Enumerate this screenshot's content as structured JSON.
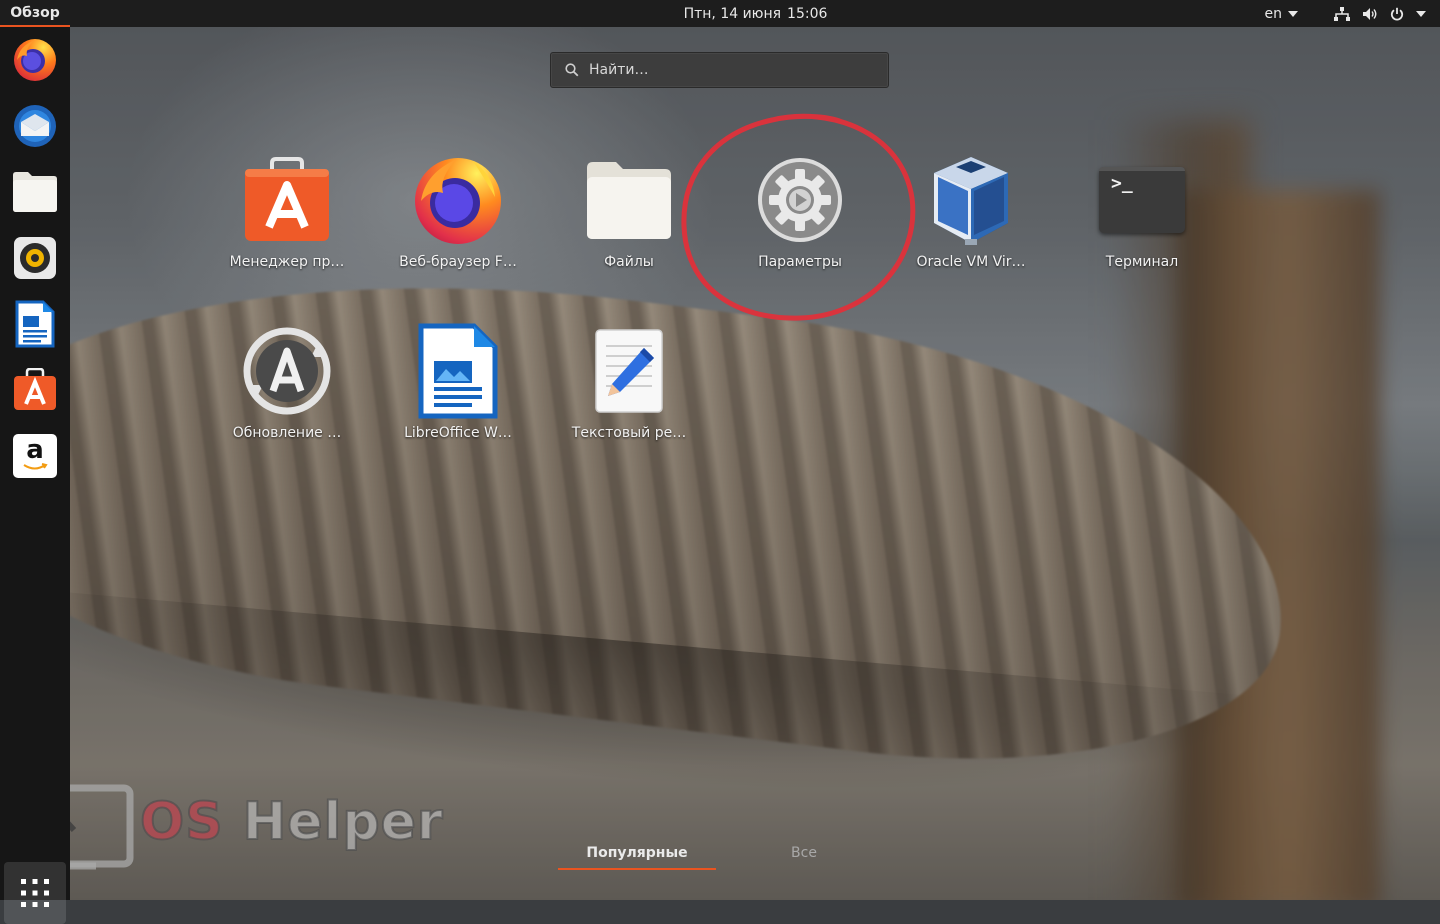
{
  "topbar": {
    "activities_label": "Обзор",
    "date": "Птн, 14 июня",
    "time": "15:06",
    "language": "en"
  },
  "dock": {
    "items": [
      {
        "name": "firefox",
        "icon": "firefox-icon"
      },
      {
        "name": "thunderbird",
        "icon": "thunderbird-icon"
      },
      {
        "name": "files",
        "icon": "folder-icon"
      },
      {
        "name": "rhythmbox",
        "icon": "rhythmbox-icon"
      },
      {
        "name": "libreoffice-writer",
        "icon": "writer-icon"
      },
      {
        "name": "software-center",
        "icon": "software-icon"
      },
      {
        "name": "amazon",
        "icon": "amazon-icon"
      }
    ],
    "amazon_letter": "a"
  },
  "search": {
    "placeholder": "Найти…"
  },
  "apps": {
    "row1": [
      {
        "label": "Менеджер пр…",
        "icon": "software-manager-icon"
      },
      {
        "label": "Веб-браузер F…",
        "icon": "firefox-icon"
      },
      {
        "label": "Файлы",
        "icon": "folder-icon"
      },
      {
        "label": "Параметры",
        "icon": "settings-gear-icon"
      },
      {
        "label": "Oracle VM Vir…",
        "icon": "virtualbox-icon"
      },
      {
        "label": "Терминал",
        "icon": "terminal-icon"
      }
    ],
    "row2": [
      {
        "label": "Обновление …",
        "icon": "software-updater-icon"
      },
      {
        "label": "LibreOffice W…",
        "icon": "writer-icon"
      },
      {
        "label": "Текстовый ре…",
        "icon": "text-editor-icon"
      }
    ],
    "terminal_prompt": ">_"
  },
  "tabs": {
    "popular": "Популярные",
    "all": "Все"
  },
  "watermark": {
    "os": "OS",
    "helper": "Helper"
  },
  "colors": {
    "accent": "#e95420",
    "annotation": "#e0303a",
    "topbar": "#1d1d1d",
    "dock": "#161616"
  }
}
